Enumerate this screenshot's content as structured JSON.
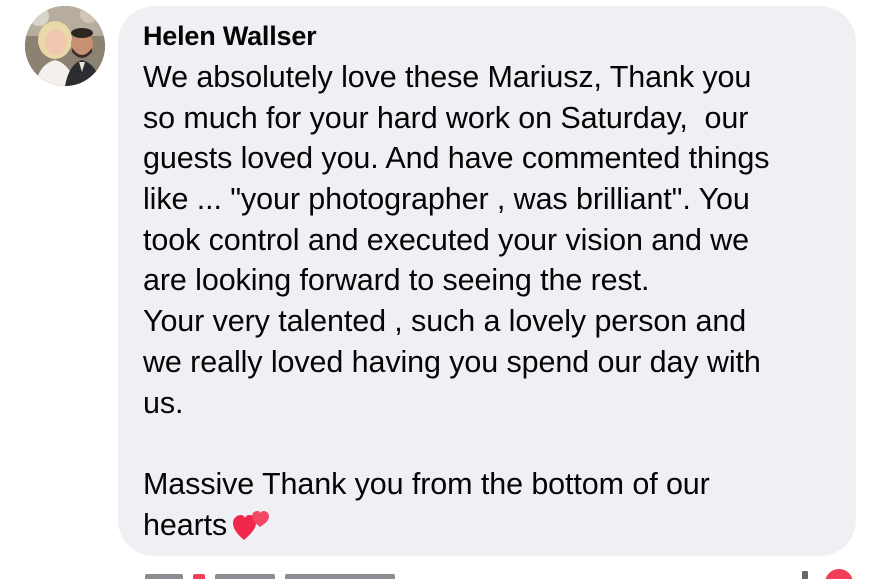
{
  "comment": {
    "author": "Helen Wallser",
    "lines": [
      "We absolutely love these Mariusz, Thank you",
      "so much for your hard work on Saturday,  our",
      "guests loved you. And have commented things",
      "like ... \"your photographer , was brilliant\". You",
      "took control and executed your vision and we",
      "are looking forward to seeing the rest.",
      "Your very talented , such a lovely person and",
      "we really loved having you spend our day with",
      "us.",
      "",
      "Massive Thank you from the bottom of our",
      "hearts"
    ],
    "emoji": "two-hearts-icon",
    "avatar": "profile-photo"
  },
  "colors": {
    "bubble": "#eff0f4",
    "text": "#050505",
    "heart": "#f33e58"
  }
}
